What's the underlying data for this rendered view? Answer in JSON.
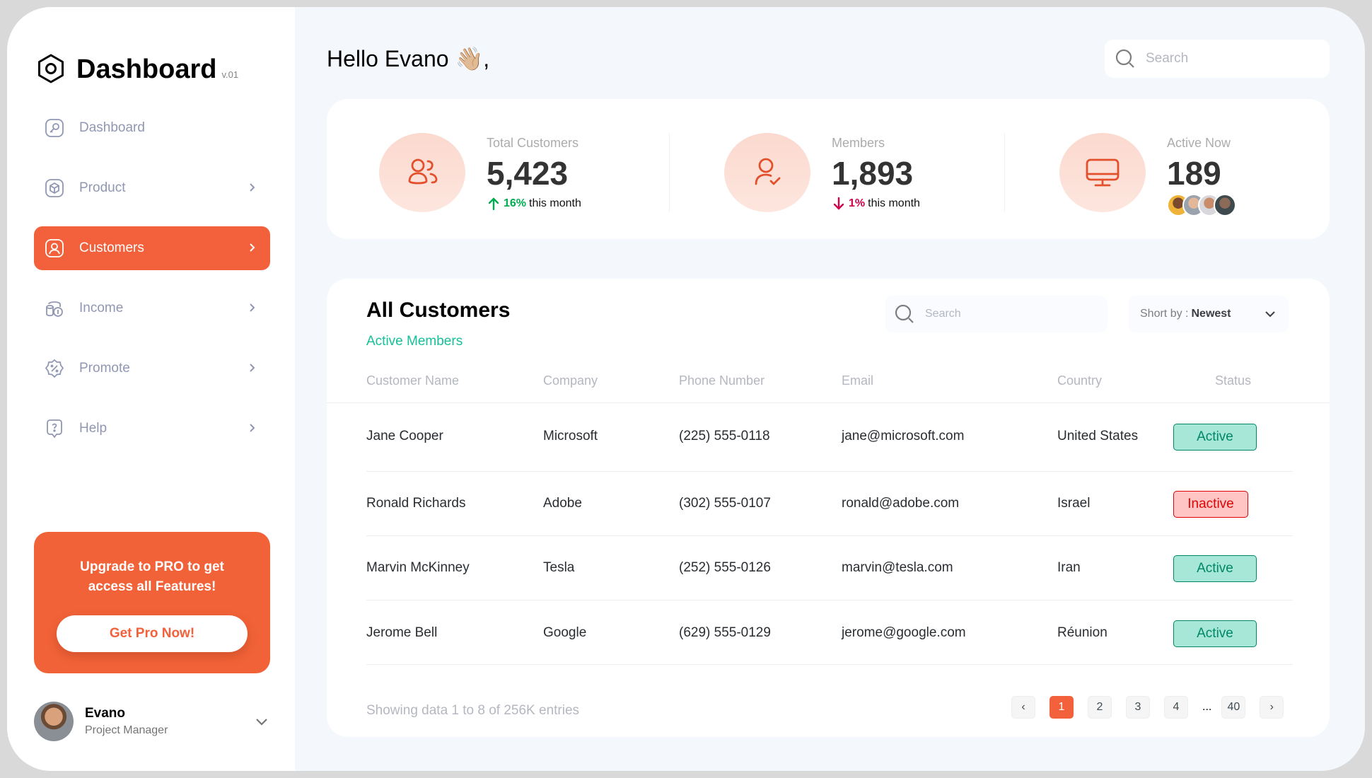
{
  "brand": {
    "title": "Dashboard",
    "version": "v.01"
  },
  "sidebar": {
    "items": [
      {
        "label": "Dashboard",
        "icon": "key-icon"
      },
      {
        "label": "Product",
        "icon": "cube-icon"
      },
      {
        "label": "Customers",
        "icon": "user-square-icon",
        "active": true
      },
      {
        "label": "Income",
        "icon": "wallet-money-icon"
      },
      {
        "label": "Promote",
        "icon": "discount-shape-icon"
      },
      {
        "label": "Help",
        "icon": "message-question-icon"
      }
    ]
  },
  "promo": {
    "text": "Upgrade to  PRO to get access all Features!",
    "button": "Get Pro Now!"
  },
  "profile": {
    "name": "Evano",
    "role": "Project Manager"
  },
  "header": {
    "greeting": "Hello Evano 👋🏼,",
    "search_placeholder": "Search"
  },
  "stats": [
    {
      "label": "Total Customers",
      "value": "5,423",
      "pct": "16%",
      "suffix": "this month",
      "direction": "up",
      "icon": "users-icon"
    },
    {
      "label": "Members",
      "value": "1,893",
      "pct": "1%",
      "suffix": "this month",
      "direction": "down",
      "icon": "user-tick-icon"
    },
    {
      "label": "Active Now",
      "value": "189",
      "icon": "monitor-icon"
    }
  ],
  "table": {
    "title": "All Customers",
    "subtitle": "Active Members",
    "search_placeholder": "Search",
    "sort_label": "Short by :",
    "sort_value": "Newest",
    "columns": [
      "Customer Name",
      "Company",
      "Phone Number",
      "Email",
      "Country",
      "Status"
    ],
    "rows": [
      [
        "Jane Cooper",
        "Microsoft",
        "(225) 555-0118",
        "jane@microsoft.com",
        "United States",
        "Active"
      ],
      [
        "Ronald Richards",
        "Adobe",
        "(302) 555-0107",
        "ronald@adobe.com",
        "Israel",
        "Inactive"
      ],
      [
        "Marvin McKinney",
        "Tesla",
        "(252) 555-0126",
        "marvin@tesla.com",
        "Iran",
        "Active"
      ],
      [
        "Jerome Bell",
        "Google",
        "(629) 555-0129",
        "jerome@google.com",
        "Réunion",
        "Active"
      ]
    ],
    "footer": "Showing data 1 to 8 of  256K entries",
    "pages": [
      "‹",
      "1",
      "2",
      "3",
      "4",
      "...",
      "40",
      "›"
    ]
  },
  "colors": {
    "accent": "#f2613b",
    "positive": "#00ac4f",
    "negative": "#d0004b",
    "teal": "#16c098"
  }
}
